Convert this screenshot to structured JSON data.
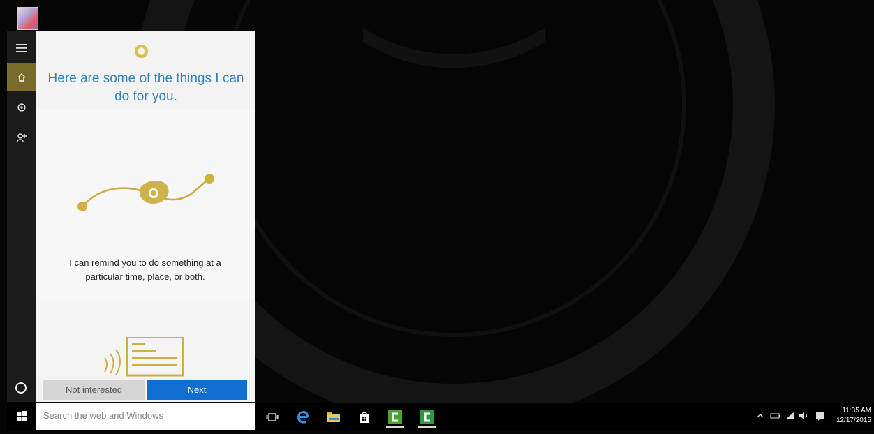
{
  "desktop": {
    "icon_name": "app-shortcut-icon"
  },
  "left_rail": {
    "items": [
      {
        "name": "hamburger-menu-icon"
      },
      {
        "name": "home-icon"
      },
      {
        "name": "settings-icon"
      },
      {
        "name": "feedback-icon"
      }
    ]
  },
  "cortana": {
    "title": "Here are some of the things I can do for you.",
    "card1_text": "I can remind you to do something at a particular time, place, or both.",
    "buttons": {
      "not_interested": "Not interested",
      "next": "Next"
    }
  },
  "taskbar": {
    "search_placeholder": "Search the web and Windows",
    "apps": [
      {
        "name": "task-view-icon"
      },
      {
        "name": "edge-icon"
      },
      {
        "name": "file-explorer-icon"
      },
      {
        "name": "store-icon"
      },
      {
        "name": "camtasia-icon"
      },
      {
        "name": "camtasia-icon"
      }
    ],
    "tray_time": "11:35 AM",
    "tray_date": "12/17/2015"
  },
  "colors": {
    "accent": "#0f6fd0",
    "gold": "#d4af37",
    "title_blue": "#2f83b8"
  }
}
